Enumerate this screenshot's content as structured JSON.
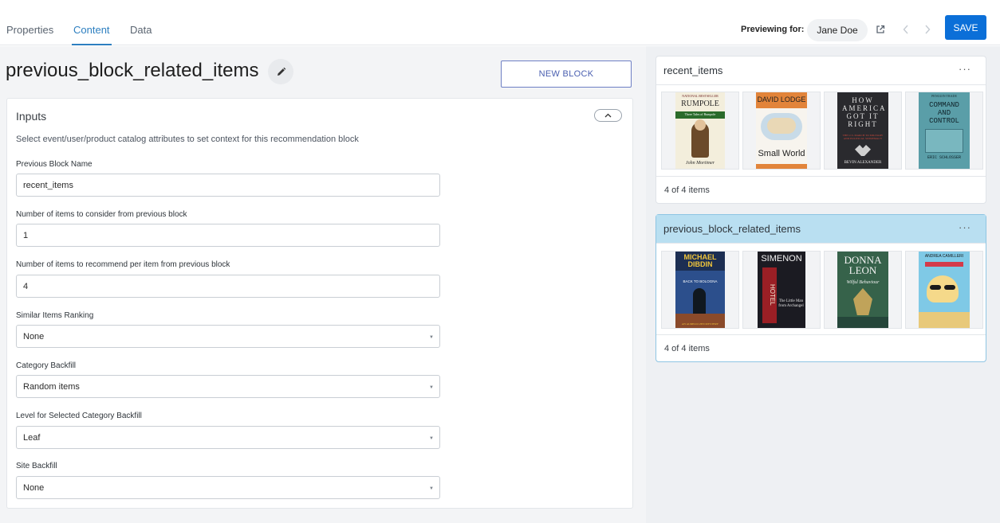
{
  "tabs": [
    {
      "label": "Properties",
      "active": false
    },
    {
      "label": "Content",
      "active": true
    },
    {
      "label": "Data",
      "active": false
    }
  ],
  "header": {
    "previewing_label": "Previewing for:",
    "user_name": "Jane Doe",
    "save_label": "SAVE",
    "icons": [
      "external-link-icon",
      "chevron-left-icon",
      "chevron-right-icon"
    ]
  },
  "editor": {
    "block_title": "previous_block_related_items",
    "new_block_label": "NEW BLOCK",
    "inputs": {
      "title": "Inputs",
      "description": "Select event/user/product catalog attributes to set context for this recommendation block",
      "fields": [
        {
          "label": "Previous Block Name",
          "value": "recent_items",
          "type": "text"
        },
        {
          "label": "Number of items to consider from previous block",
          "value": "1",
          "type": "text"
        },
        {
          "label": "Number of items to recommend per item from previous block",
          "value": "4",
          "type": "text"
        },
        {
          "label": "Similar Items Ranking",
          "value": "None",
          "type": "select"
        },
        {
          "label": "Category Backfill",
          "value": "Random items",
          "type": "select"
        },
        {
          "label": "Level for Selected Category Backfill",
          "value": "Leaf",
          "type": "select"
        },
        {
          "label": "Site Backfill",
          "value": "None",
          "type": "select"
        }
      ]
    }
  },
  "preview": {
    "blocks": [
      {
        "name": "recent_items",
        "selected": false,
        "count_text": "4 of 4 items",
        "books": [
          {
            "name": "book-cover-rumpole",
            "publisher": "NATIONAL BESTSELLER",
            "title": "RUMPOLE",
            "subtitle": "Three Tales of Rumpole",
            "author": "John Mortimer"
          },
          {
            "name": "book-cover-small-world",
            "author": "DAVID LODGE",
            "title": "Small World"
          },
          {
            "name": "book-cover-how-america-got-it-right",
            "title": "HOW AMERICA GOT IT RIGHT",
            "subtitle": "THE U.S. MARCH TO MILITARY AND POLITICAL SUPREMACY",
            "author": "BEVIN ALEXANDER"
          },
          {
            "name": "book-cover-command-and-control",
            "publisher": "PENGUIN TRADE",
            "title": "COMMAND AND CONTROL",
            "author": "ERIC SCHLOSSER"
          }
        ]
      },
      {
        "name": "previous_block_related_items",
        "selected": true,
        "count_text": "4 of 4 items",
        "books": [
          {
            "name": "book-cover-back-to-bologna",
            "author": "MICHAEL DIBDIN",
            "title": "BACK TO BOLOGNA",
            "subtitle": "AN AURELIO ZEN MYSTERY"
          },
          {
            "name": "book-cover-the-little-man-from-archangel",
            "author": "SIMENON",
            "title": "HOTEL",
            "subtitle": "The Little Man from Archangel"
          },
          {
            "name": "book-cover-wilful-behaviour",
            "author": "DONNA LEON",
            "title": "Wilful Behaviour"
          },
          {
            "name": "book-cover-andrea-camilleri",
            "author": "ANDREA CAMILLERI"
          }
        ]
      }
    ]
  },
  "colors": {
    "accent": "#2d7fc0",
    "save_button": "#0b6fd8",
    "selected_header": "#b9dff1",
    "new_block_border": "#6d7fc4"
  }
}
